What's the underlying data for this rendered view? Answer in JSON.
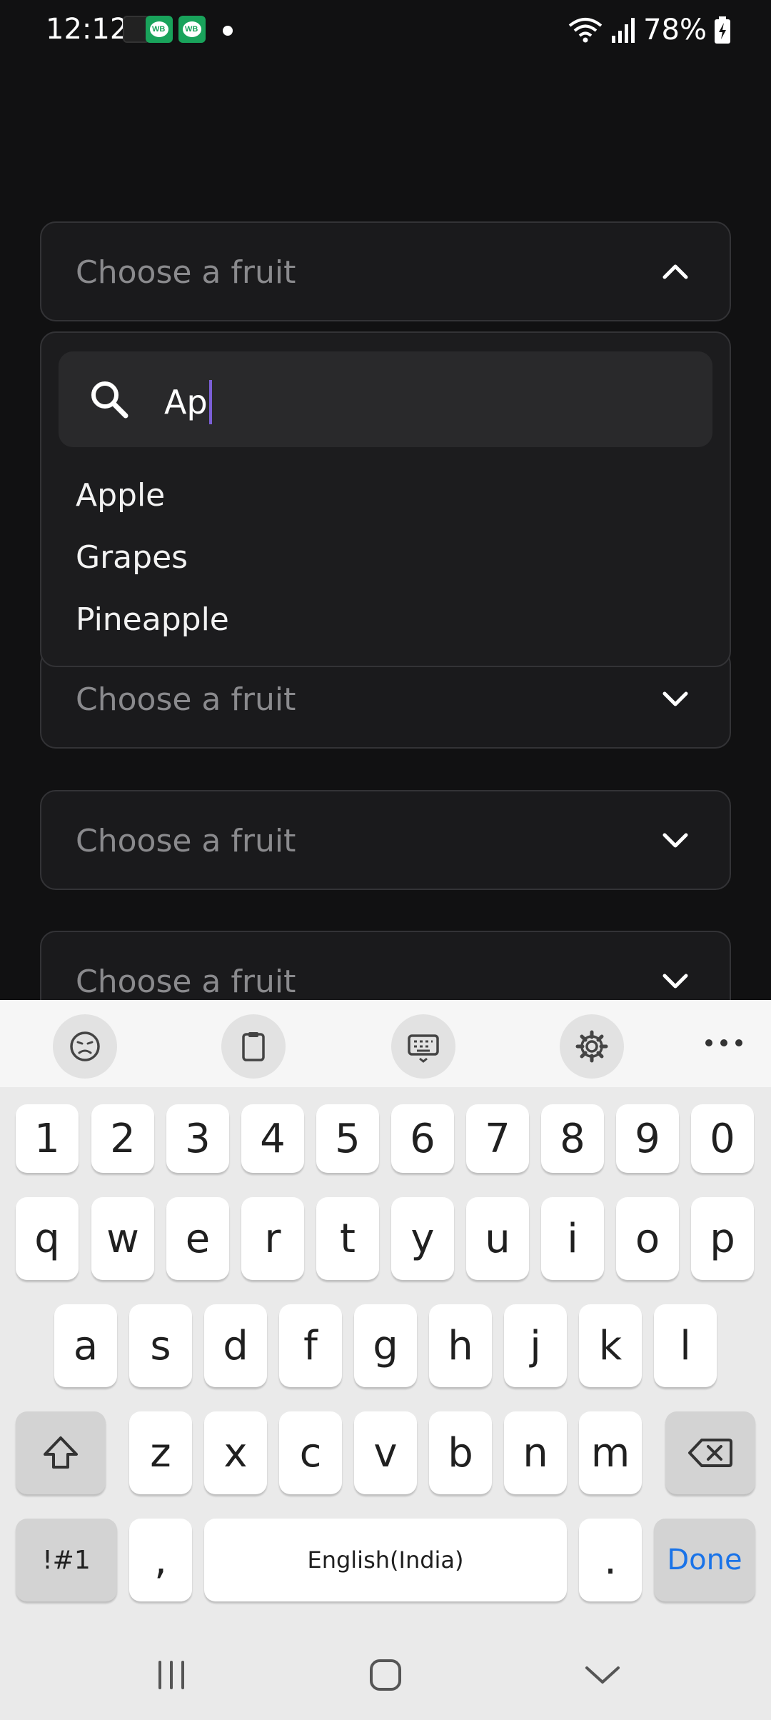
{
  "status_bar": {
    "time": "12:12",
    "battery": "78%"
  },
  "dropdown": {
    "placeholder": "Choose a fruit",
    "search_value": "Ap",
    "options": [
      "Apple",
      "Grapes",
      "Pineapple"
    ]
  },
  "keyboard": {
    "row_numbers": [
      "1",
      "2",
      "3",
      "4",
      "5",
      "6",
      "7",
      "8",
      "9",
      "0"
    ],
    "row_top": [
      "q",
      "w",
      "e",
      "r",
      "t",
      "y",
      "u",
      "i",
      "o",
      "p"
    ],
    "row_middle": [
      "a",
      "s",
      "d",
      "f",
      "g",
      "h",
      "j",
      "k",
      "l"
    ],
    "row_bottom": [
      "z",
      "x",
      "c",
      "v",
      "b",
      "n",
      "m"
    ],
    "symbols_label": "!#1",
    "comma_label": ",",
    "space_label": "English(India)",
    "period_label": ".",
    "done_label": "Done"
  },
  "colors": {
    "background": "#111112",
    "field_border": "#333336",
    "caret": "#7b5fd6",
    "done_accent": "#1a73e8"
  }
}
